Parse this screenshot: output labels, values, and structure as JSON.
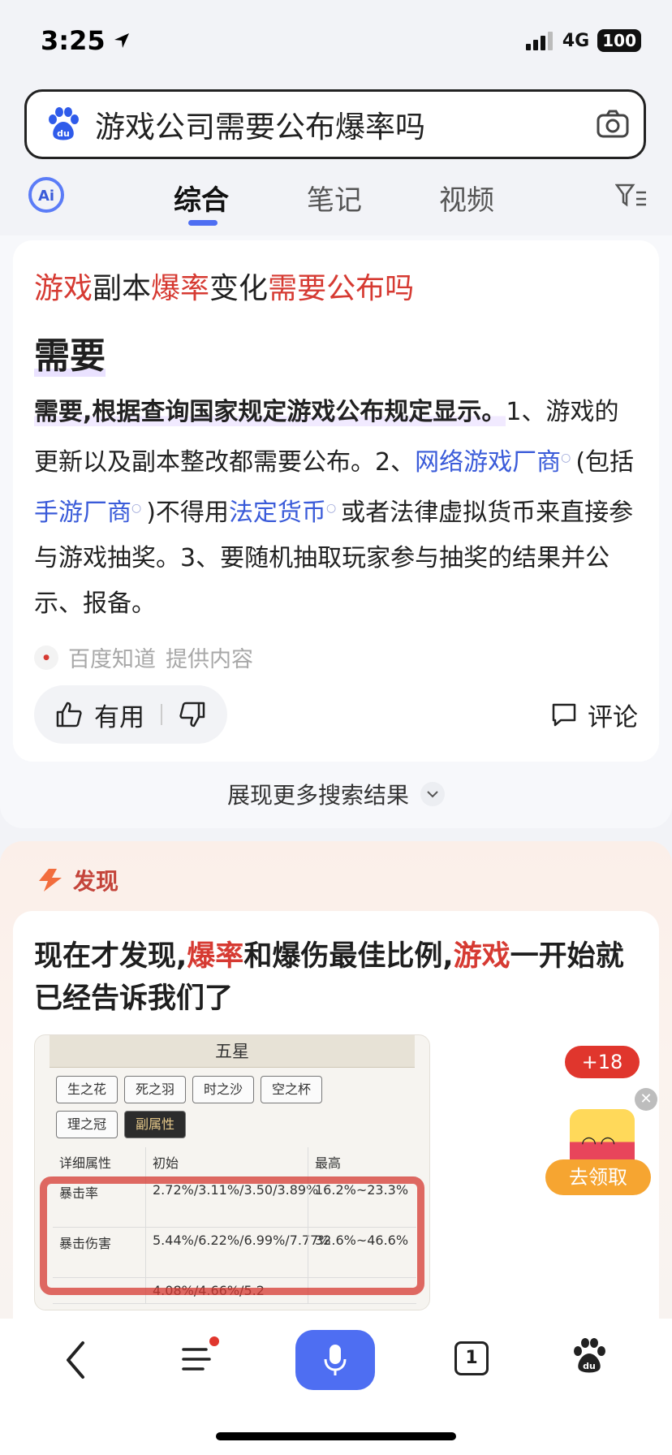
{
  "status_bar": {
    "time": "3:25",
    "network": "4G",
    "battery": "100"
  },
  "search": {
    "query": "游戏公司需要公布爆率吗"
  },
  "tabs": [
    {
      "label": "综合",
      "active": true
    },
    {
      "label": "笔记",
      "active": false
    },
    {
      "label": "视频",
      "active": false
    }
  ],
  "result": {
    "title_parts": [
      {
        "text": "游戏",
        "red": true
      },
      {
        "text": "副本",
        "red": false
      },
      {
        "text": "爆率",
        "red": true
      },
      {
        "text": "变化",
        "red": false
      },
      {
        "text": "需要公布吗",
        "red": true
      }
    ],
    "answer": "需要",
    "body": {
      "p1": "需要,根据查询国家规定游戏公布规定显示。",
      "p2": "1、游戏的更新以及副本整改都需要公布。2、",
      "link1": "网络游戏厂商",
      "p3": "(包括",
      "link2": "手游厂商",
      "p4": ")不得用",
      "link3": "法定货币",
      "p5": "或者法律虚拟货币来直接参与游戏抽奖。3、要随机抽取玩家参与抽奖的结果并公示、报备。"
    },
    "source_name": "百度知道",
    "source_suffix": "提供内容",
    "useful_label": "有用",
    "comment_label": "评论"
  },
  "more_results": "展现更多搜索结果",
  "discover": {
    "label": "发现",
    "headline_parts": [
      {
        "text": "现在才发现,",
        "red": false
      },
      {
        "text": "爆率",
        "red": true
      },
      {
        "text": "和爆伤最佳比例,",
        "red": false
      },
      {
        "text": "游戏",
        "red": true
      },
      {
        "text": "一开始就已经告诉我们了",
        "red": false
      }
    ],
    "thumbnail": {
      "header": "五星",
      "chips": [
        "生之花",
        "死之羽",
        "时之沙",
        "空之杯",
        "理之冠",
        "副属性"
      ],
      "table_headers": [
        "详细属性",
        "初始",
        "最高"
      ],
      "rows": [
        [
          "暴击率",
          "2.72%/3.11%/3.50/3.89%",
          "16.2%~23.3%"
        ],
        [
          "暴击伤害",
          "5.44%/6.22%/6.99%/7.77%",
          "32.6%~46.6%"
        ],
        [
          "",
          "4.08%/4.66%/5.2",
          ""
        ]
      ]
    }
  },
  "reward": {
    "badge": "+18",
    "claim_label": "去领取"
  },
  "bottom_bar": {
    "tab_count": "1"
  },
  "colors": {
    "accent": "#4e6ef2",
    "highlight_red": "#d63a32",
    "link_blue": "#3a5bd9"
  }
}
